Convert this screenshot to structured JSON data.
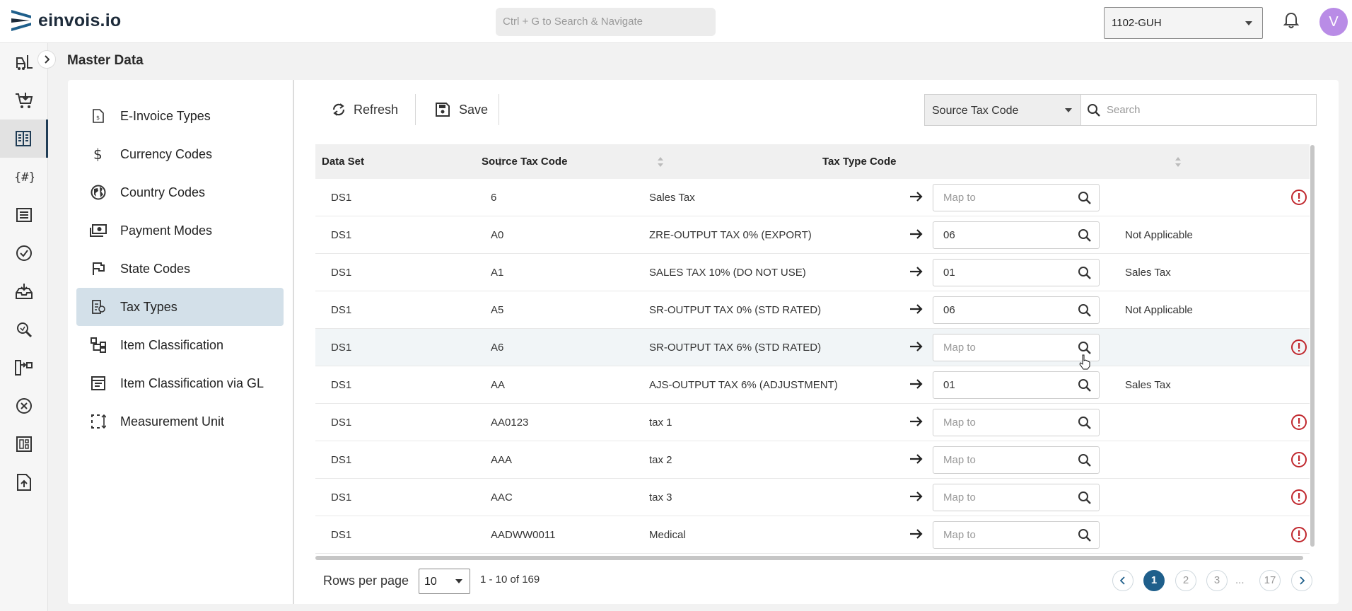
{
  "app": {
    "logo_text": "einvois.io",
    "search_placeholder": "Ctrl + G to Search & Navigate",
    "org_selected": "1102-GUH",
    "avatar_initial": "V",
    "accent_color": "#1f5f8b",
    "avatar_color": "#b98ce6"
  },
  "rail": {
    "items": [
      "forklift-icon",
      "cart-icon",
      "ledger-icon",
      "hash-braces-icon",
      "list-icon",
      "check-circle-icon",
      "inbox-download-icon",
      "search-zoom-icon",
      "flow-icon",
      "cancel-circle-icon",
      "dashboard-icon",
      "upload-file-icon"
    ],
    "active_index": 2
  },
  "page": {
    "title": "Master Data"
  },
  "nav": {
    "items": [
      {
        "label": "E-Invoice Types",
        "icon": "invoice-icon"
      },
      {
        "label": "Currency Codes",
        "icon": "dollar-icon"
      },
      {
        "label": "Country Codes",
        "icon": "globe-icon"
      },
      {
        "label": "Payment Modes",
        "icon": "cash-icon"
      },
      {
        "label": "State Codes",
        "icon": "flag-icon"
      },
      {
        "label": "Tax Types",
        "icon": "tax-document-icon"
      },
      {
        "label": "Item Classification",
        "icon": "hierarchy-icon"
      },
      {
        "label": "Item Classification via GL",
        "icon": "list-box-icon"
      },
      {
        "label": "Measurement Unit",
        "icon": "measure-icon"
      }
    ],
    "active_index": 5
  },
  "toolbar": {
    "refresh_label": "Refresh",
    "save_label": "Save",
    "filter_field": "Source Tax Code",
    "search_placeholder": "Search"
  },
  "table": {
    "columns": [
      "Data Set",
      "Source Tax Code",
      "Tax Type Code"
    ],
    "map_placeholder": "Map to",
    "rows": [
      {
        "data_set": "DS1",
        "code": "6",
        "description": "Sales Tax",
        "mapped": "",
        "result": "",
        "warning": true
      },
      {
        "data_set": "DS1",
        "code": "A0",
        "description": "ZRE-OUTPUT TAX 0% (EXPORT)",
        "mapped": "06",
        "result": "Not Applicable",
        "warning": false
      },
      {
        "data_set": "DS1",
        "code": "A1",
        "description": "SALES TAX 10% (DO NOT USE)",
        "mapped": "01",
        "result": "Sales Tax",
        "warning": false
      },
      {
        "data_set": "DS1",
        "code": "A5",
        "description": "SR-OUTPUT TAX 0% (STD RATED)",
        "mapped": "06",
        "result": "Not Applicable",
        "warning": false
      },
      {
        "data_set": "DS1",
        "code": "A6",
        "description": "SR-OUTPUT TAX 6% (STD RATED)",
        "mapped": "",
        "result": "",
        "warning": true
      },
      {
        "data_set": "DS1",
        "code": "AA",
        "description": "AJS-OUTPUT TAX 6% (ADJUSTMENT)",
        "mapped": "01",
        "result": "Sales Tax",
        "warning": false
      },
      {
        "data_set": "DS1",
        "code": "AA0123",
        "description": "tax 1",
        "mapped": "",
        "result": "",
        "warning": true
      },
      {
        "data_set": "DS1",
        "code": "AAA",
        "description": "tax 2",
        "mapped": "",
        "result": "",
        "warning": true
      },
      {
        "data_set": "DS1",
        "code": "AAC",
        "description": "tax 3",
        "mapped": "",
        "result": "",
        "warning": true
      },
      {
        "data_set": "DS1",
        "code": "AADWW0011",
        "description": "Medical",
        "mapped": "",
        "result": "",
        "warning": true
      }
    ],
    "hover_row": 4
  },
  "footer": {
    "rows_per_page_label": "Rows per page",
    "rows_per_page": "10",
    "range": "1 - 10 of 169",
    "pages": [
      "1",
      "2",
      "3"
    ],
    "ellipsis": "...",
    "last_page": "17",
    "current_page": "1"
  }
}
